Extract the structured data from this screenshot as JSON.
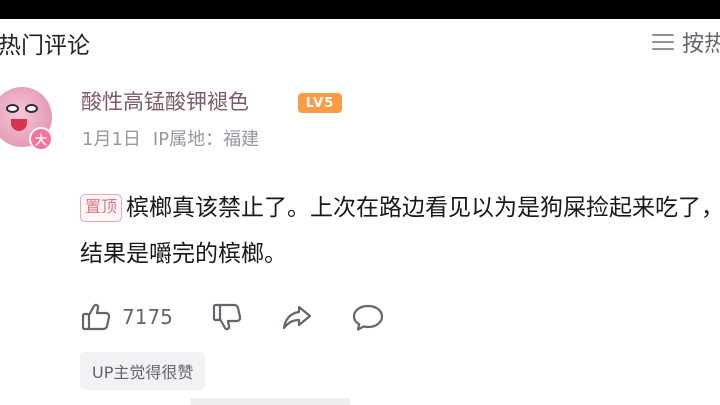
{
  "header": {
    "title": "热门评论",
    "sort_label": "按热"
  },
  "comment": {
    "username": "酸性高锰酸钾褪色",
    "level": "LV5",
    "date": "1月1日",
    "location": "IP属地：福建",
    "pin_label": "置顶",
    "text": "槟榔真该禁止了。上次在路边看见以为是狗屎捡起来吃了，结果是嚼完的槟榔。",
    "likes": "7175",
    "up_badge": "UP主觉得很赞"
  },
  "icons": {
    "avatar_badge": "大",
    "sort": "list-sort-icon",
    "like": "thumbs-up-icon",
    "dislike": "thumbs-down-icon",
    "share": "share-icon",
    "reply": "comment-bubble-icon"
  },
  "colors": {
    "username": "#7d5a68",
    "level_badge": "#ff9c43",
    "pin_border": "#f0a5b4",
    "meta_text": "#9499a0",
    "icon_gray": "#61666d"
  }
}
